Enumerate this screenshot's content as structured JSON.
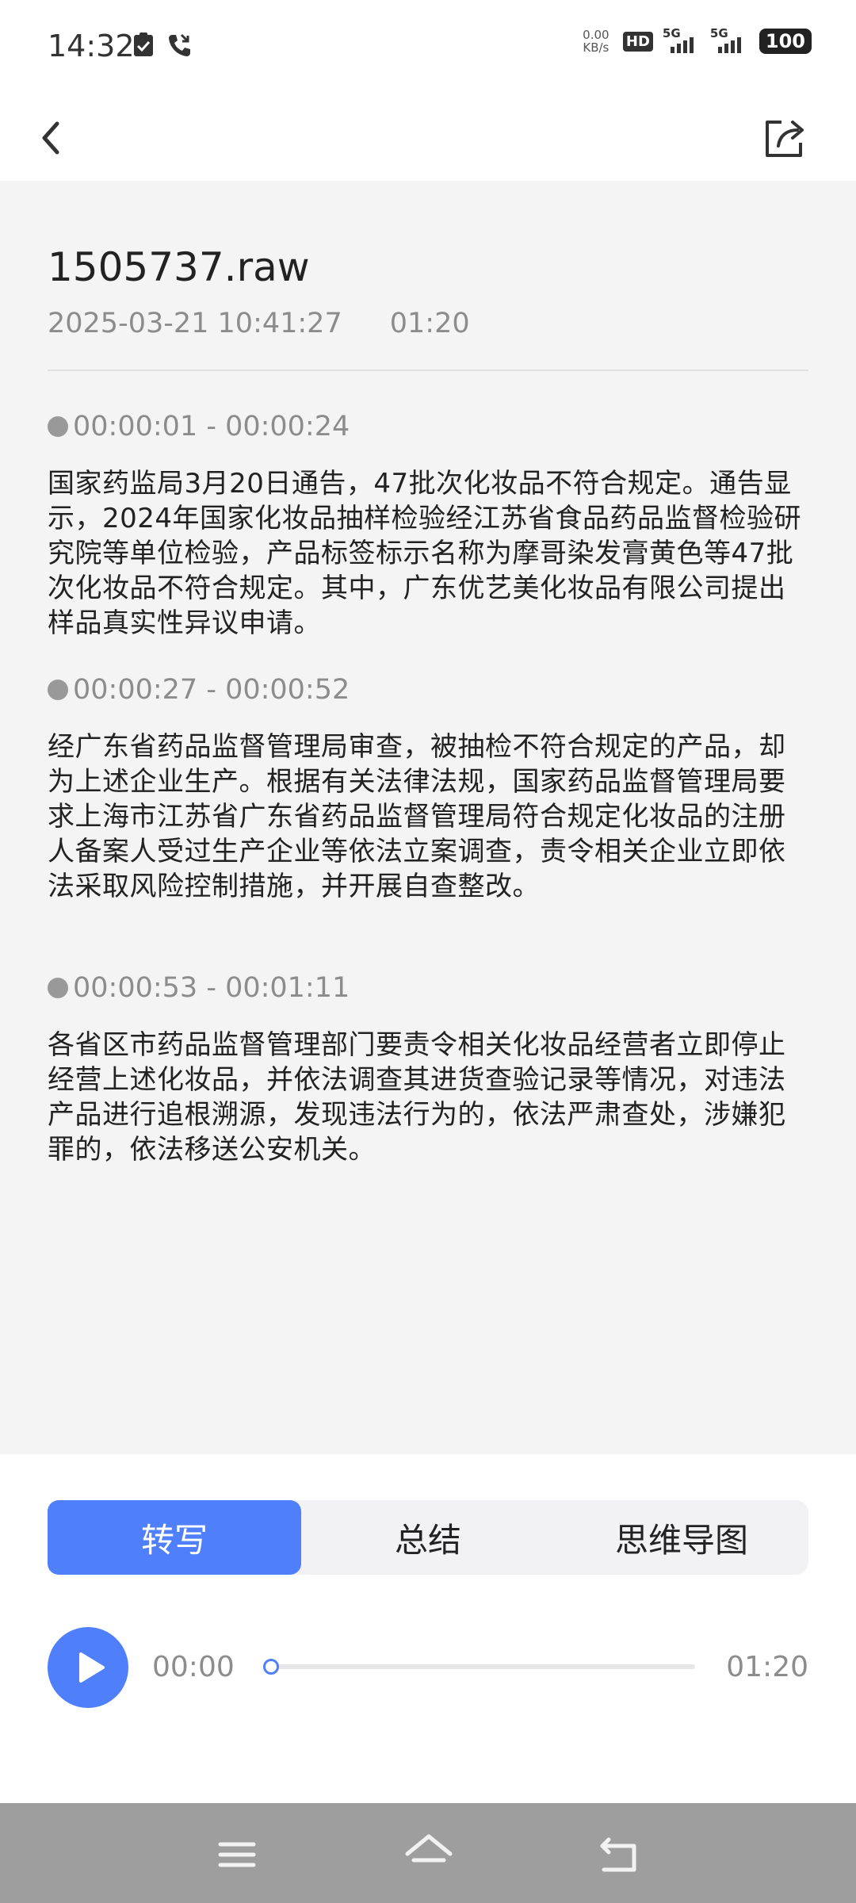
{
  "status_bar": {
    "time": "14:32",
    "net_speed_value": "0.00",
    "net_speed_unit": "KB/s",
    "hd_label": "HD",
    "sim1_label": "5G",
    "sim2_label": "5G",
    "battery": "100",
    "icons": [
      "check-clipboard-icon",
      "missed-call-icon",
      "hd-icon",
      "signal-icon",
      "battery-icon"
    ]
  },
  "header": {
    "back_icon": "chevron-left-icon",
    "share_icon": "share-icon"
  },
  "recording": {
    "title": "1505737.raw",
    "datetime": "2025-03-21 10:41:27",
    "duration": "01:20"
  },
  "transcript": [
    {
      "time": "00:00:01 - 00:00:24",
      "text": "国家药监局3月20日通告，47批次化妆品不符合规定。通告显示，2024年国家化妆品抽样检验经江苏省食品药品监督检验研究院等单位检验，产品标签标示名称为摩哥染发膏黄色等47批次化妆品不符合规定。其中，广东优艺美化妆品有限公司提出样品真实性异议申请。"
    },
    {
      "time": "00:00:27 - 00:00:52",
      "text": "经广东省药品监督管理局审查，被抽检不符合规定的产品，却为上述企业生产。根据有关法律法规，国家药品监督管理局要求上海市江苏省广东省药品监督管理局符合规定化妆品的注册人备案人受过生产企业等依法立案调查，责令相关企业立即依法采取风险控制措施，并开展自查整改。"
    },
    {
      "time": "00:00:53 - 00:01:11",
      "text": "各省区市药品监督管理部门要责令相关化妆品经营者立即停止经营上述化妆品，并依法调查其进货查验记录等情况，对违法产品进行追根溯源，发现违法行为的，依法严肃查处，涉嫌犯罪的，依法移送公安机关。"
    }
  ],
  "tabs": [
    {
      "label": "转写",
      "active": true
    },
    {
      "label": "总结",
      "active": false
    },
    {
      "label": "思维导图",
      "active": false
    }
  ],
  "player": {
    "current_time": "00:00",
    "total_time": "01:20",
    "progress": 0,
    "play_icon": "play-icon"
  },
  "system_nav": {
    "icons": [
      "menu-icon",
      "home-icon",
      "back-icon"
    ]
  },
  "colors": {
    "accent": "#4f7ffb",
    "content_bg": "#f4f4f5",
    "secondary_text": "#8c8c8c",
    "system_nav_bg": "#9e9e9e"
  }
}
